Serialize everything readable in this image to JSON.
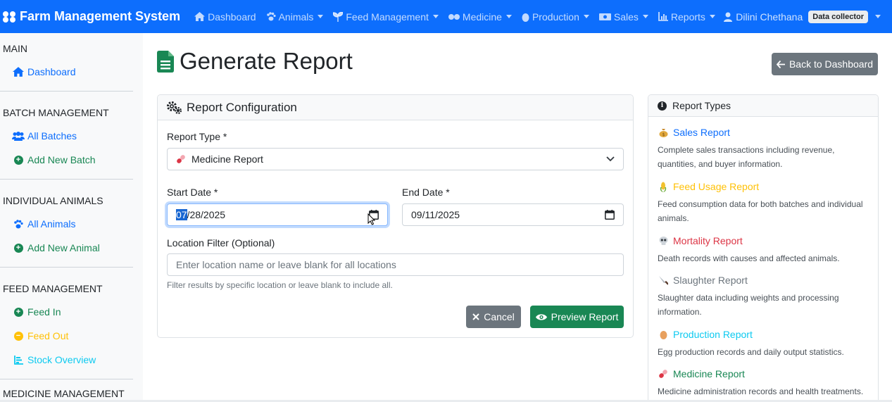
{
  "navbar": {
    "brand": "Farm Management System",
    "items": [
      {
        "label": "Dashboard",
        "icon": "home-icon",
        "dropdown": false
      },
      {
        "label": "Animals",
        "icon": "paw-icon",
        "dropdown": true
      },
      {
        "label": "Feed Management",
        "icon": "seedling-icon",
        "dropdown": true
      },
      {
        "label": "Medicine",
        "icon": "pills-icon",
        "dropdown": true
      },
      {
        "label": "Production",
        "icon": "egg-icon",
        "dropdown": true
      },
      {
        "label": "Sales",
        "icon": "money-icon",
        "dropdown": true
      },
      {
        "label": "Reports",
        "icon": "chart-icon",
        "dropdown": true
      }
    ],
    "user": {
      "name": "Dilini Chethana",
      "role": "Data collector"
    }
  },
  "sidebar": {
    "main": {
      "title": "MAIN",
      "items": [
        {
          "label": "Dashboard"
        }
      ]
    },
    "batch": {
      "title": "BATCH MANAGEMENT",
      "items": [
        {
          "label": "All Batches"
        },
        {
          "label": "Add New Batch"
        }
      ]
    },
    "individual": {
      "title": "INDIVIDUAL ANIMALS",
      "items": [
        {
          "label": "All Animals"
        },
        {
          "label": "Add New Animal"
        }
      ]
    },
    "feed": {
      "title": "FEED MANAGEMENT",
      "items": [
        {
          "label": "Feed In"
        },
        {
          "label": "Feed Out"
        },
        {
          "label": "Stock Overview"
        }
      ]
    },
    "medicine": {
      "title": "MEDICINE MANAGEMENT"
    }
  },
  "page": {
    "title": "Generate Report",
    "back_label": "Back to Dashboard"
  },
  "config": {
    "header": "Report Configuration",
    "report_type_label": "Report Type *",
    "report_type_value": "Medicine Report",
    "start_label": "Start Date *",
    "start_month": "07",
    "start_rest": "/28/2025",
    "end_label": "End Date *",
    "end_value": "09/11/2025",
    "location_label": "Location Filter (Optional)",
    "location_placeholder": "Enter location name or leave blank for all locations",
    "location_help": "Filter results by specific location or leave blank to include all.",
    "cancel_label": "Cancel",
    "preview_label": "Preview Report"
  },
  "report_types": {
    "header": "Report Types",
    "items": [
      {
        "title": "Sales Report",
        "desc": "Complete sales transactions including revenue, quantities, and buyer information.",
        "color": "#0d6efd",
        "icon": "money-bag-icon"
      },
      {
        "title": "Feed Usage Report",
        "desc": "Feed consumption data for both batches and individual animals.",
        "color": "#ffc107",
        "icon": "corn-icon"
      },
      {
        "title": "Mortality Report",
        "desc": "Death records with causes and affected animals.",
        "color": "#dc3545",
        "icon": "skull-icon"
      },
      {
        "title": "Slaughter Report",
        "desc": "Slaughter data including weights and processing information.",
        "color": "#6c757d",
        "icon": "knife-icon"
      },
      {
        "title": "Production Report",
        "desc": "Egg production records and daily output statistics.",
        "color": "#0dcaf0",
        "icon": "egg-icon"
      },
      {
        "title": "Medicine Report",
        "desc": "Medicine administration records and health treatments.",
        "color": "#198754",
        "icon": "pill-icon"
      }
    ]
  },
  "colors": {
    "primary": "#0d6efd",
    "success": "#198754",
    "secondary": "#6c757d",
    "warning": "#ffc107"
  }
}
